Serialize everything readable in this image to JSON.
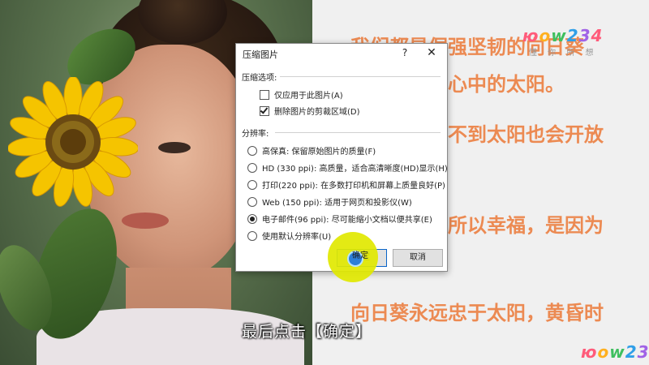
{
  "slide": {
    "lines": [
      "我们都是倔强坚韧的向日葵",
      "心中的太阳。",
      "不到太阳也会开放",
      "所以幸福，是因为",
      "向日葵永远忠于太阳，黄昏时"
    ]
  },
  "watermark": {
    "logo_chars": [
      "ю",
      "o",
      "w",
      "2",
      "3",
      "4"
    ],
    "sub": "懂 你 所 想"
  },
  "dialog": {
    "title": "压缩图片",
    "help_label": "?",
    "close_label": "✕",
    "compress_options_label": "压缩选项:",
    "checkbox_apply_only": {
      "label": "仅应用于此图片(A)",
      "checked": false
    },
    "checkbox_delete_cropped": {
      "label": "删除图片的剪裁区域(D)",
      "checked": true
    },
    "resolution_label": "分辨率:",
    "resolution_options": [
      {
        "label": "高保真: 保留原始图片的质量(F)",
        "selected": false
      },
      {
        "label": "HD (330 ppi): 高质量，适合高清晰度(HD)显示(H)",
        "selected": false
      },
      {
        "label": "打印(220 ppi): 在多数打印机和屏幕上质量良好(P)",
        "selected": false
      },
      {
        "label": "Web (150 ppi): 适用于网页和投影仪(W)",
        "selected": false
      },
      {
        "label": "电子邮件(96 ppi): 尽可能缩小文档以便共享(E)",
        "selected": true
      },
      {
        "label": "使用默认分辨率(U)",
        "selected": false
      }
    ],
    "ok_label": "确定",
    "cancel_label": "取消"
  },
  "subtitle": "最后点击【确定】",
  "colors": {
    "slide_text": "#ec8a52",
    "highlight": "#e1e800",
    "cursor": "#2c7fd8"
  }
}
